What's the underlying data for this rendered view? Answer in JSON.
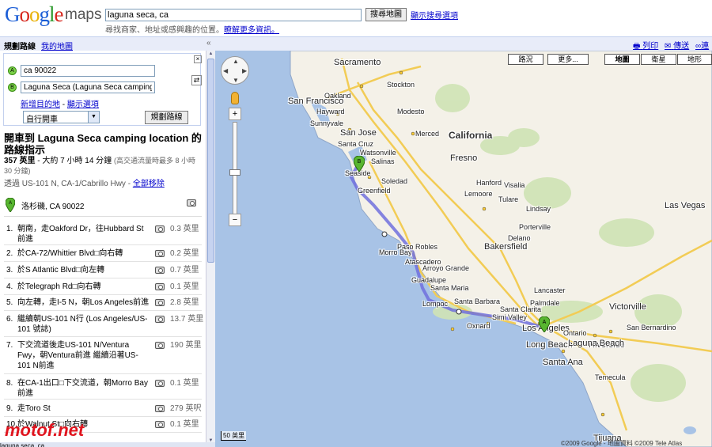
{
  "header": {
    "logo_google": "Google",
    "logo_maps": "maps",
    "search_value": "laguna seca, ca",
    "search_button": "搜尋地圖",
    "search_options": "顯示搜尋選項",
    "hint_text": "尋找商家、地址或感興趣的位置。",
    "hint_link": "瞭解更多資訊。"
  },
  "topbar": {
    "directions_tab": "規劃路線",
    "my_maps_tab": "我的地圖",
    "collapse": "«",
    "print": "列印",
    "send": "傳送",
    "link": "連結"
  },
  "directions": {
    "point_a_badge": "A",
    "point_b_badge": "B",
    "point_a": "ca 90022",
    "point_b": "Laguna Seca (Laguna Seca camping location",
    "close": "×",
    "swap": "⇄",
    "add_destination": "新增目的地",
    "show_options": "顯示選項",
    "mode": "自行開車",
    "route_button": "規劃路線",
    "title": "開車到 Laguna Seca camping location 的路線指示",
    "distance": "357 英里",
    "duration": "大約 7 小時 14 分鐘",
    "traffic_note": "(高交通流量時最多 8 小時 30 分鐘)",
    "via_prefix": "透過 US-101 N, CA-1/Cabrillo Hwy",
    "remove_all": "全部移除",
    "start_location": "洛杉磯, CA 90022",
    "steps": [
      {
        "num": "1.",
        "text": "朝南，走Oakford Dr，往Hubbard St前進",
        "dist": "0.3 英里"
      },
      {
        "num": "2.",
        "text": "於CA-72/Whittier Blvd□向右轉",
        "dist": "0.2 英里"
      },
      {
        "num": "3.",
        "text": "於S Atlantic Blvd□向左轉",
        "dist": "0.7 英里"
      },
      {
        "num": "4.",
        "text": "於Telegraph Rd□向右轉",
        "dist": "0.1 英里"
      },
      {
        "num": "5.",
        "text": "向左轉，走I-5 N，朝Los Angeles前進",
        "dist": "2.8 英里"
      },
      {
        "num": "6.",
        "text": "繼續朝US-101 N行 (Los Angeles/US-101 號誌)",
        "dist": "13.7 英里"
      },
      {
        "num": "7.",
        "text": "下交流道後走US-101 N/Ventura Fwy，朝Ventura前進 繼續沿著US-101 N前進",
        "dist": "190 英里"
      },
      {
        "num": "8.",
        "text": "在CA-1出口□下交流道，朝Morro Bay前進",
        "dist": "0.1 英里"
      },
      {
        "num": "9.",
        "text": "走Toro St",
        "dist": "279 英呎"
      },
      {
        "num": "10.",
        "text": "於Walnut St□向右轉",
        "dist": "0.1 英里"
      }
    ]
  },
  "watermark": "motof.net",
  "bottom_text": "laguna seca, ca",
  "map": {
    "type_buttons": {
      "traffic": "路況",
      "more": "更多...",
      "map": "地圖",
      "satellite": "衛星",
      "terrain": "地形"
    },
    "scale_km": "50 英里",
    "copyright": "©2009 Google - 地圖資料 ©2009 Tele Atlas",
    "marker_a": "A",
    "marker_b": "B",
    "colors": {
      "water": "#a8c3e6",
      "land": "#f4f1e8",
      "route": "#7070dd",
      "highway": "#f2cc55"
    },
    "cities": [
      {
        "name": "Sacramento",
        "size": "big"
      },
      {
        "name": "Stockton"
      },
      {
        "name": "San Francisco",
        "size": "big"
      },
      {
        "name": "Oakland"
      },
      {
        "name": "Hayward"
      },
      {
        "name": "Sunnyvale"
      },
      {
        "name": "San Jose",
        "size": "big"
      },
      {
        "name": "Modesto"
      },
      {
        "name": "Merced"
      },
      {
        "name": "Santa Cruz"
      },
      {
        "name": "Watsonville"
      },
      {
        "name": "Salinas"
      },
      {
        "name": "Seaside"
      },
      {
        "name": "Soledad"
      },
      {
        "name": "Greenfield"
      },
      {
        "name": "California",
        "size": "lg"
      },
      {
        "name": "Fresno",
        "size": "big"
      },
      {
        "name": "Visalia"
      },
      {
        "name": "Tulare"
      },
      {
        "name": "Paso Robles"
      },
      {
        "name": "Atascadero"
      },
      {
        "name": "Morro Bay"
      },
      {
        "name": "Arroyo Grande"
      },
      {
        "name": "Santa Maria"
      },
      {
        "name": "Guadalupe"
      },
      {
        "name": "Lompoc"
      },
      {
        "name": "Bakersfield",
        "size": "big"
      },
      {
        "name": "Lancaster"
      },
      {
        "name": "Palmdale"
      },
      {
        "name": "Santa Barbara"
      },
      {
        "name": "Santa Clarita"
      },
      {
        "name": "Oxnard"
      },
      {
        "name": "Simi Valley"
      },
      {
        "name": "Los Angeles",
        "size": "big"
      },
      {
        "name": "Long Beach"
      },
      {
        "name": "Santa Ana"
      },
      {
        "name": "Victorville"
      },
      {
        "name": "San Bernardino"
      },
      {
        "name": "Riverside"
      },
      {
        "name": "Ontario"
      },
      {
        "name": "Laguna Beach"
      },
      {
        "name": "Temecula"
      },
      {
        "name": "Las Vegas",
        "size": "big"
      },
      {
        "name": "Tijuana",
        "size": "big"
      },
      {
        "name": "Lindsay"
      },
      {
        "name": "Porterville"
      },
      {
        "name": "Delano"
      },
      {
        "name": "Hanford"
      },
      {
        "name": "Lemoore"
      }
    ]
  }
}
